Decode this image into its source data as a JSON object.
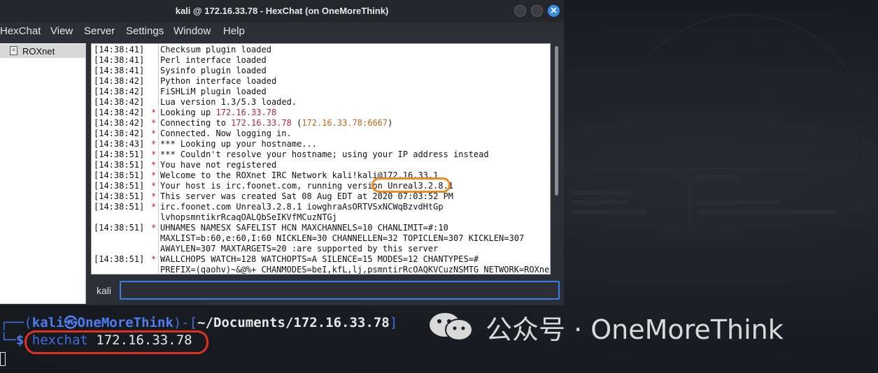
{
  "window": {
    "title": "kali @ 172.16.33.78 - HexChat (on OneMoreThink)",
    "close_glyph": "✕"
  },
  "menu": [
    "HexChat",
    "View",
    "Server",
    "Settings",
    "Window",
    "Help"
  ],
  "sidebar": {
    "network": "ROXnet"
  },
  "chat": {
    "lines": [
      {
        "ts": "[14:38:41]",
        "star": "",
        "text": "Checksum plugin loaded"
      },
      {
        "ts": "[14:38:41]",
        "star": "",
        "text": "Perl interface loaded"
      },
      {
        "ts": "[14:38:41]",
        "star": "",
        "text": "Sysinfo plugin loaded"
      },
      {
        "ts": "[14:38:42]",
        "star": "",
        "text": "Python interface loaded"
      },
      {
        "ts": "[14:38:42]",
        "star": "",
        "text": "FiSHLiM plugin loaded"
      },
      {
        "ts": "[14:38:42]",
        "star": "",
        "text": "Lua version 1.3/5.3 loaded."
      },
      {
        "ts": "[14:38:42]",
        "star": "*",
        "pre": "Looking up ",
        "hl": "172.16.33.78",
        "post": ""
      },
      {
        "ts": "[14:38:42]",
        "star": "*",
        "pre": "Connecting to ",
        "hl": "172.16.33.78",
        "mid": " (",
        "hl2": "172.16.33.78:6667",
        "post": ")"
      },
      {
        "ts": "[14:38:42]",
        "star": "*",
        "text": "Connected. Now logging in."
      },
      {
        "ts": "[14:38:43]",
        "star": "*",
        "text": "*** Looking up your hostname..."
      },
      {
        "ts": "[14:38:51]",
        "star": "*",
        "text": "*** Couldn't resolve your hostname; using your IP address instead"
      },
      {
        "ts": "[14:38:51]",
        "star": "*",
        "text": "You have not registered"
      },
      {
        "ts": "[14:38:51]",
        "star": "*",
        "text": "Welcome to the ROXnet IRC Network kali!kali@172.16.33.1"
      },
      {
        "ts": "[14:38:51]",
        "star": "*",
        "text": "Your host is irc.foonet.com, running version Unreal3.2.8.1"
      },
      {
        "ts": "[14:38:51]",
        "star": "*",
        "text": "This server was created Sat 08 Aug EDT at 2020 07:03:52 PM"
      },
      {
        "ts": "[14:38:51]",
        "star": "*",
        "text": "irc.foonet.com Unreal3.2.8.1 iowghraAsORTVSxNCWqBzvdHtGp"
      },
      {
        "ts": "",
        "star": "",
        "text": "lvhopsmntikrRcaqOALQbSeIKVfMCuzNTGj"
      },
      {
        "ts": "[14:38:51]",
        "star": "*",
        "text": "UHNAMES NAMESX SAFELIST HCN MAXCHANNELS=10 CHANLIMIT=#:10"
      },
      {
        "ts": "",
        "star": "",
        "text": "MAXLIST=b:60,e:60,I:60 NICKLEN=30 CHANNELLEN=32 TOPICLEN=307 KICKLEN=307"
      },
      {
        "ts": "",
        "star": "",
        "text": "AWAYLEN=307 MAXTARGETS=20 :are supported by this server"
      },
      {
        "ts": "[14:38:51]",
        "star": "*",
        "text": "WALLCHOPS WATCH=128 WATCHOPTS=A SILENCE=15 MODES=12 CHANTYPES=#"
      },
      {
        "ts": "",
        "star": "",
        "text": "PREFIX=(qaohv)~&@%+ CHANMODES=beI,kfL,lj,psmntirRcOAQKVCuzNSMTG NETWORK=ROXnet"
      }
    ]
  },
  "input": {
    "nick": "kali",
    "value": ""
  },
  "terminal": {
    "prompt_open": "┌──(",
    "user": "kali",
    "at_glyph": "㉿",
    "host": "OneMoreThink",
    "prompt_mid": ")-[",
    "path": "~/Documents/172.16.33.78",
    "prompt_close": "]",
    "prompt_2": "└─",
    "dollar": "$ ",
    "command": "hexchat",
    "argument": " 172.16.33.78"
  },
  "watermark": {
    "text": "公众号 · OneMoreThink",
    "icon": "wechat-icon"
  },
  "colors": {
    "highlight_orange": "#ef8a1f",
    "highlight_red": "#e0301e",
    "accent_blue": "#3584e4"
  }
}
